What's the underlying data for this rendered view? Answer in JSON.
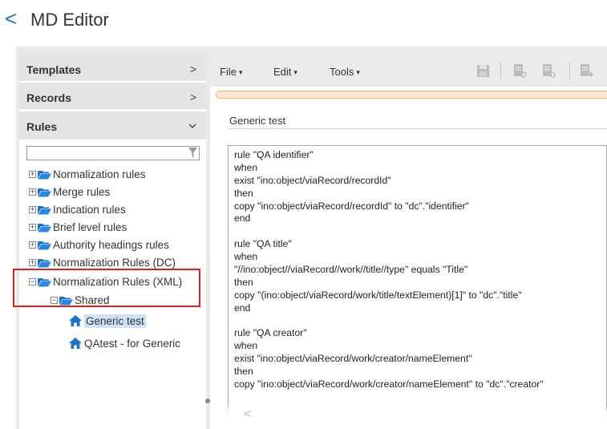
{
  "header": {
    "back_glyph": "<",
    "title": "MD Editor"
  },
  "sidebar": {
    "sections": [
      {
        "label": "Templates",
        "chevron": ">"
      },
      {
        "label": "Records",
        "chevron": ">"
      },
      {
        "label": "Rules",
        "chevron": "v"
      }
    ],
    "filter": {
      "value": "",
      "placeholder": ""
    },
    "tree": [
      {
        "label": "Normalization rules",
        "toggle": "+"
      },
      {
        "label": "Merge rules",
        "toggle": "+"
      },
      {
        "label": "Indication rules",
        "toggle": "+"
      },
      {
        "label": "Brief level rules",
        "toggle": "+"
      },
      {
        "label": "Authority headings rules",
        "toggle": "+"
      },
      {
        "label": "Normalization Rules (DC)",
        "toggle": "+"
      },
      {
        "label": "Normalization Rules (XML)",
        "toggle": "−"
      },
      {
        "label": "Shared",
        "toggle": "−"
      },
      {
        "label": "Generic test",
        "selected": true
      },
      {
        "label": "QAtest - for Generic",
        "selected": false
      }
    ]
  },
  "toolbar": {
    "menus": [
      {
        "label": "File",
        "caret": "▾"
      },
      {
        "label": "Edit",
        "caret": "▾"
      },
      {
        "label": "Tools",
        "caret": "▾"
      }
    ],
    "icons": [
      "save-icon",
      "record-view-icon",
      "record-search-icon",
      "record-add-icon"
    ]
  },
  "editor": {
    "document_name": "Generic test",
    "lines": [
      "rule \"QA identifier\"",
      "when",
      "exist \"ino:object/viaRecord/recordId\"",
      "then",
      "copy \"ino:object/viaRecord/recordId\" to \"dc\".\"identifier\"",
      "end",
      "",
      "rule \"QA title\"",
      "when",
      "\"//ino:object//viaRecord//work//title//type\" equals \"Title\"",
      "then",
      "copy \"(ino:object/viaRecord/work/title/textElement)[1]\" to \"dc\".\"title\"",
      "end",
      "",
      "rule \"QA creator\"",
      "when",
      "exist \"ino:object/viaRecord/work/creator/nameElement\"",
      "then",
      "copy \"ino:object/viaRecord/work/creator/nameElement\" to \"dc\".\"creator\""
    ],
    "hscroll_glyph": "<"
  },
  "colors": {
    "accent": "#1a73c8",
    "folder": "#1a73c8",
    "highlight_box": "#e02020",
    "selection": "#cfe1f7",
    "progress_border": "#f0b070"
  }
}
